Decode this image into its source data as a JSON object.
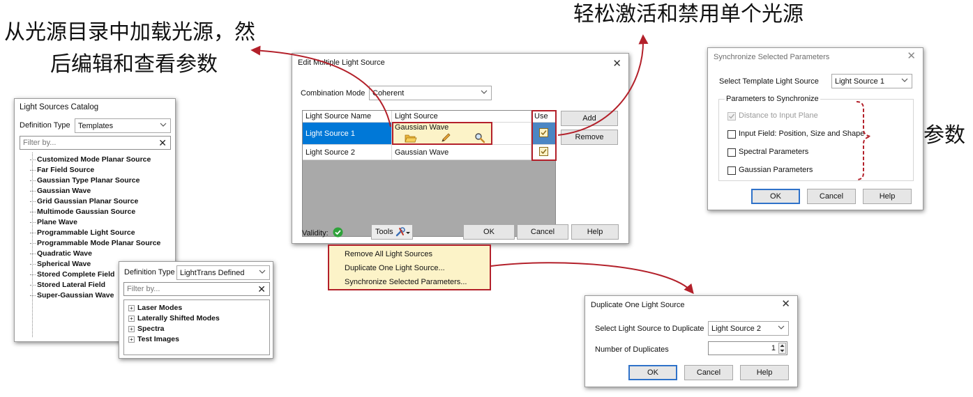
{
  "annotations": {
    "catalog_caption_line1": "从光源目录中加载光源，然",
    "catalog_caption_line2": "后编辑和查看参数",
    "toggle_caption": "轻松激活和禁用单个光源",
    "sync_caption": "同步参数"
  },
  "catalog": {
    "title": "Light Sources Catalog",
    "definition_type_label": "Definition Type",
    "definition_type_value": "Templates",
    "filter_placeholder": "Filter by...",
    "items": [
      "Customized Mode Planar Source",
      "Far Field Source",
      "Gaussian Type Planar Source",
      "Gaussian Wave",
      "Grid Gaussian Planar Source",
      "Multimode Gaussian Source",
      "Plane Wave",
      "Programmable Light Source",
      "Programmable Mode Planar Source",
      "Quadratic Wave",
      "Spherical Wave",
      "Stored Complete Field",
      "Stored Lateral Field",
      "Super-Gaussian Wave"
    ]
  },
  "catalog2": {
    "definition_type_label": "Definition Type",
    "definition_type_value": "LightTrans Defined",
    "filter_placeholder": "Filter by...",
    "items": [
      "Laser Modes",
      "Laterally Shifted Modes",
      "Spectra",
      "Test Images"
    ]
  },
  "edit_dialog": {
    "title": "Edit Multiple Light Source",
    "combination_mode_label": "Combination Mode",
    "combination_mode_value": "Coherent",
    "columns": [
      "Light Source Name",
      "Light Source",
      "Use"
    ],
    "rows": [
      {
        "name": "Light Source 1",
        "source": "Gaussian Wave",
        "use": true
      },
      {
        "name": "Light Source 2",
        "source": "Gaussian Wave",
        "use": true
      }
    ],
    "add_label": "Add",
    "remove_label": "Remove",
    "validity_label": "Validity:",
    "tools_label": "Tools",
    "ok_label": "OK",
    "cancel_label": "Cancel",
    "help_label": "Help"
  },
  "tools_menu": {
    "items": [
      "Remove All Light Sources",
      "Duplicate One Light Source...",
      "Synchronize Selected Parameters..."
    ]
  },
  "sync_dialog": {
    "title": "Synchronize Selected Parameters",
    "template_label": "Select Template Light Source",
    "template_value": "Light Source 1",
    "group_label": "Parameters to Synchronize",
    "params": [
      {
        "label": "Distance to Input Plane",
        "checked": true,
        "disabled": true
      },
      {
        "label": "Input Field: Position, Size and Shape",
        "checked": false,
        "disabled": false
      },
      {
        "label": "Spectral Parameters",
        "checked": false,
        "disabled": false
      },
      {
        "label": "Gaussian Parameters",
        "checked": false,
        "disabled": false
      }
    ],
    "ok_label": "OK",
    "cancel_label": "Cancel",
    "help_label": "Help"
  },
  "dup_dialog": {
    "title": "Duplicate One Light Source",
    "select_label": "Select Light Source to Duplicate",
    "select_value": "Light Source 2",
    "number_label": "Number of Duplicates",
    "number_value": "1",
    "ok_label": "OK",
    "cancel_label": "Cancel",
    "help_label": "Help"
  },
  "colors": {
    "annotation_red": "#b3202a",
    "selection_blue": "#0078d7",
    "highlight_yellow": "#fcf3c8",
    "validity_green": "#2ea33a"
  }
}
